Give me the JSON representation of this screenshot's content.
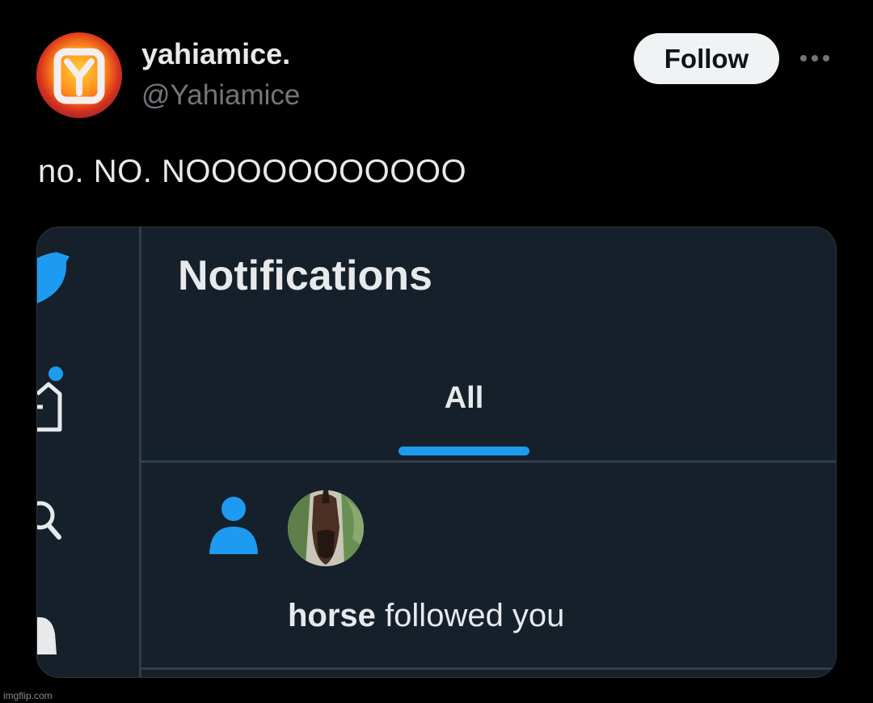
{
  "tweet": {
    "display_name": "yahiamice.",
    "handle": "@Yahiamice",
    "follow_label": "Follow",
    "text": "no. NO. NOOOOOOOOOOO"
  },
  "screenshot": {
    "title": "Notifications",
    "tab_label": "All",
    "notification": {
      "username": "horse",
      "action": "followed you"
    }
  },
  "watermark": "imgflip.com",
  "colors": {
    "background": "#000000",
    "follow_button": "#eff3f4",
    "accent_blue": "#1d9bf0",
    "inner_background": "#15202b"
  },
  "icons": [
    "yahiamice-logo-icon",
    "more-options-icon",
    "twitter-bird-icon",
    "home-icon",
    "search-icon",
    "bell-icon",
    "person-icon",
    "horse-avatar"
  ]
}
